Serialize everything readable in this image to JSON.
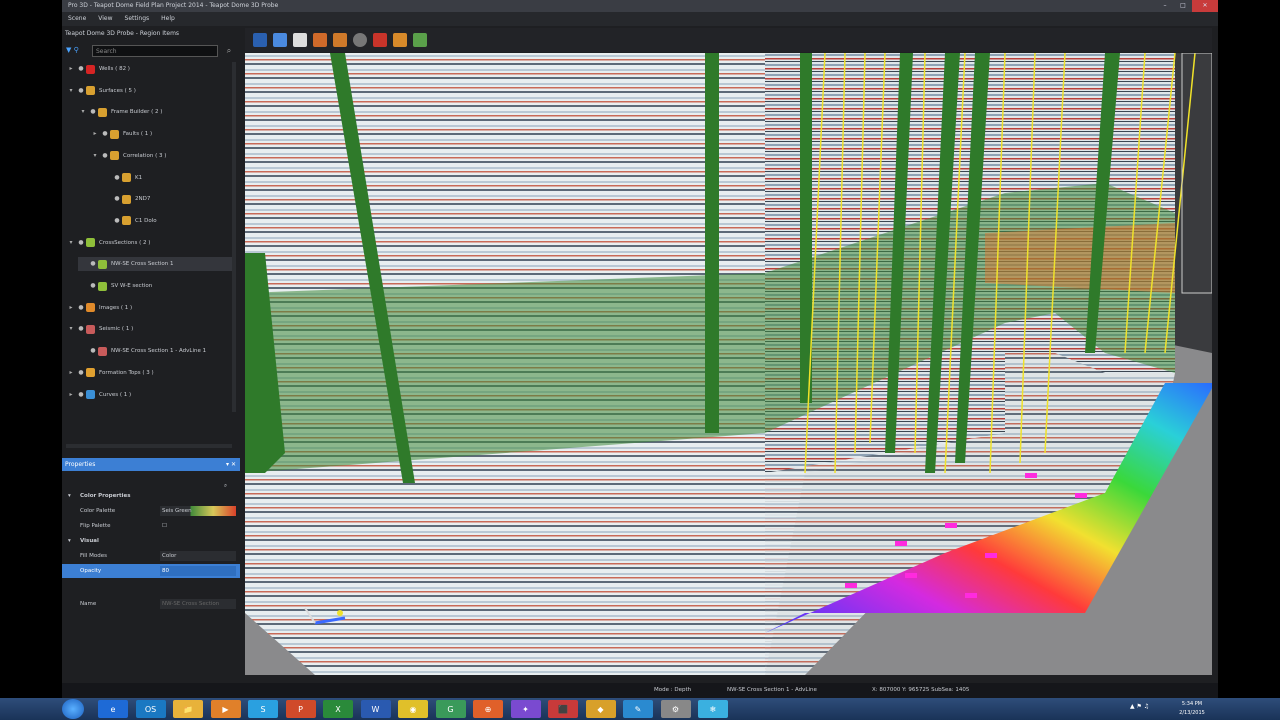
{
  "window": {
    "title": "Pro 3D - Teapot Dome Field Plan Project 2014 - Teapot Dome 3D Probe",
    "controls": [
      "–",
      "□",
      "✕"
    ]
  },
  "menu": [
    "Scene",
    "View",
    "Settings",
    "Help"
  ],
  "explorer": {
    "title": "Teapot Dome 3D Probe - Region Items",
    "search_placeholder": "Search",
    "items": [
      {
        "label": "Wells ( 82 )",
        "level": 0,
        "expand": "▸",
        "color": "#d62424"
      },
      {
        "label": "Surfaces ( 5 )",
        "level": 0,
        "expand": "▾",
        "color": "#d8a030"
      },
      {
        "label": "Frame Builder ( 2 )",
        "level": 1,
        "expand": "▾",
        "color": "#d8a030"
      },
      {
        "label": "Faults ( 1 )",
        "level": 2,
        "expand": "▸",
        "color": "#d8a030"
      },
      {
        "label": "Correlation ( 3 )",
        "level": 2,
        "expand": "▾",
        "color": "#d8a030"
      },
      {
        "label": "K1",
        "level": 3,
        "expand": "",
        "color": "#d8a030"
      },
      {
        "label": "2ND7",
        "level": 3,
        "expand": "",
        "color": "#d8a030"
      },
      {
        "label": "C1 Dolo",
        "level": 3,
        "expand": "",
        "color": "#d8a030"
      },
      {
        "label": "CrossSections ( 2 )",
        "level": 0,
        "expand": "▾",
        "color": "#8fbf3a"
      },
      {
        "label": "NW-SE Cross Section 1",
        "level": 1,
        "expand": "",
        "color": "#8fbf3a"
      },
      {
        "label": "SV W-E section",
        "level": 1,
        "expand": "",
        "color": "#8fbf3a"
      },
      {
        "label": "Images ( 1 )",
        "level": 0,
        "expand": "▸",
        "color": "#e08a2a"
      },
      {
        "label": "Seismic ( 1 )",
        "level": 0,
        "expand": "▾",
        "color": "#c85b5b"
      },
      {
        "label": "NW-SE Cross Section 1 - AdvLine 1",
        "level": 1,
        "expand": "",
        "color": "#c85b5b"
      },
      {
        "label": "Formation Tops ( 3 )",
        "level": 0,
        "expand": "▸",
        "color": "#e0a030"
      },
      {
        "label": "Curves ( 1 )",
        "level": 0,
        "expand": "▸",
        "color": "#3a8fd6"
      }
    ],
    "selected_index": 9
  },
  "properties": {
    "title": "Properties",
    "sections": [
      {
        "name": "Color Properties"
      },
      {
        "label": "Color Palette",
        "value": "Seis Green"
      },
      {
        "label": "Flip Palette",
        "value": "☐"
      },
      {
        "name": "Visual"
      },
      {
        "label": "Fill Modes",
        "value": "Color"
      },
      {
        "label": "Opacity",
        "value": "80"
      },
      {
        "label": "Name",
        "value": "NW-SE Cross Section"
      }
    ]
  },
  "status": {
    "mode": "Mode : Depth",
    "section": "NW-SE Cross Section 1 - AdvLine",
    "coords": "X: 807000  Y: 965725  SubSea: 1405"
  },
  "taskbar": {
    "apps": [
      "e",
      "OS",
      "📁",
      "▶",
      "S",
      "P",
      "X",
      "W",
      "◉",
      "G",
      "⊕",
      "✦",
      "⬛",
      "◆",
      "✎",
      "⚙",
      "❄"
    ],
    "time": "5:34 PM",
    "date": "2/13/2015"
  },
  "colors": {
    "accent": "#3c7fd4",
    "panel": "#1e1f22",
    "seismic_green": "#2f7a2a"
  }
}
